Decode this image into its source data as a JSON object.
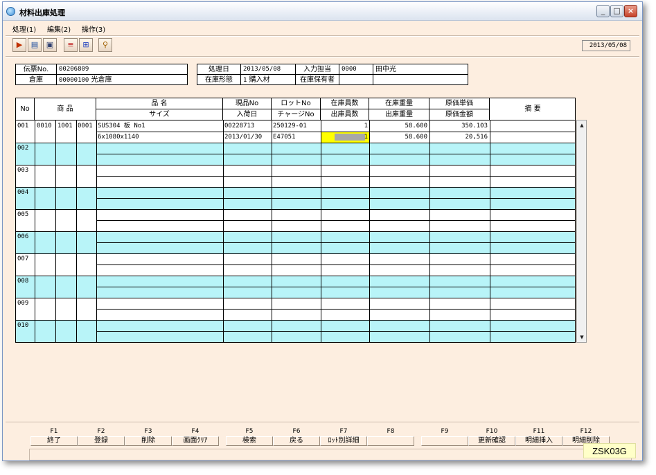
{
  "window": {
    "title": "材料出庫処理"
  },
  "menu": [
    "処理(1)",
    "編集(2)",
    "操作(3)"
  ],
  "toolbar": {
    "icons": [
      "exit-icon",
      "book-icon",
      "save-icon",
      "split-icon",
      "layout-icon",
      "search-icon"
    ],
    "date": "2013/05/08"
  },
  "header": {
    "denpyo_label": "伝票No.",
    "denpyo_value": "00206809",
    "soko_label": "倉庫",
    "soko_code": "00000100",
    "soko_name": "光倉庫",
    "shoribi_label": "処理日",
    "shoribi_value": "2013/05/08",
    "tanto_label": "入力担当",
    "tanto_code": "0000",
    "tanto_name": "田中光",
    "keitai_label": "在庫形態",
    "keitai_code": "1",
    "keitai_name": "購入材",
    "hoyu_label": "在庫保有者",
    "hoyu_code": "",
    "hoyu_name": ""
  },
  "grid": {
    "headers": {
      "no": "No",
      "shohin": "商 品",
      "hinmei": "品 名",
      "size": "サイズ",
      "genpin": "現品No",
      "nyukabi": "入荷日",
      "lot": "ロットNo",
      "charge": "チャージNo",
      "zaiko_su": "在庫員数",
      "shukko_su": "出庫員数",
      "zaiko_ju": "在庫重量",
      "shukko_ju": "出庫重量",
      "genka_tanka": "原価単価",
      "genka_kingaku": "原価金額",
      "tekiyo": "摘 要"
    },
    "rows": [
      {
        "no": "001",
        "c1": "0010",
        "c2": "1001",
        "c3": "0001",
        "hinmei": "SUS304 板 No1",
        "size": "6x1080x1140",
        "genpin": "00228713",
        "nyukabi": "2013/01/30",
        "lot": "250129-01",
        "charge": "E47051",
        "zaiko_su": "1",
        "shukko_su": "1",
        "zaiko_ju": "58.600",
        "shukko_ju": "58.600",
        "tanka": "350.103",
        "kingaku": "20,516",
        "tekiyo": ""
      },
      {
        "no": "002"
      },
      {
        "no": "003"
      },
      {
        "no": "004"
      },
      {
        "no": "005"
      },
      {
        "no": "006"
      },
      {
        "no": "007"
      },
      {
        "no": "008"
      },
      {
        "no": "009"
      },
      {
        "no": "010"
      }
    ]
  },
  "fkeys": [
    {
      "key": "F1",
      "label": "終了"
    },
    {
      "key": "F2",
      "label": "登録"
    },
    {
      "key": "F3",
      "label": "削除"
    },
    {
      "key": "F4",
      "label": "画面ｸﾘｱ"
    },
    {
      "key": "F5",
      "label": "検索"
    },
    {
      "key": "F6",
      "label": "戻る"
    },
    {
      "key": "F7",
      "label": "ﾛｯﾄ別詳細"
    },
    {
      "key": "F8",
      "label": ""
    },
    {
      "key": "F9",
      "label": ""
    },
    {
      "key": "F10",
      "label": "更新確認"
    },
    {
      "key": "F11",
      "label": "明細挿入"
    },
    {
      "key": "F12",
      "label": "明細削除"
    }
  ],
  "screen_id": "ZSK03G",
  "colors": {
    "background": "#fdeee0",
    "row_alt": "#b8f4f8",
    "selected": "#ffff00"
  }
}
